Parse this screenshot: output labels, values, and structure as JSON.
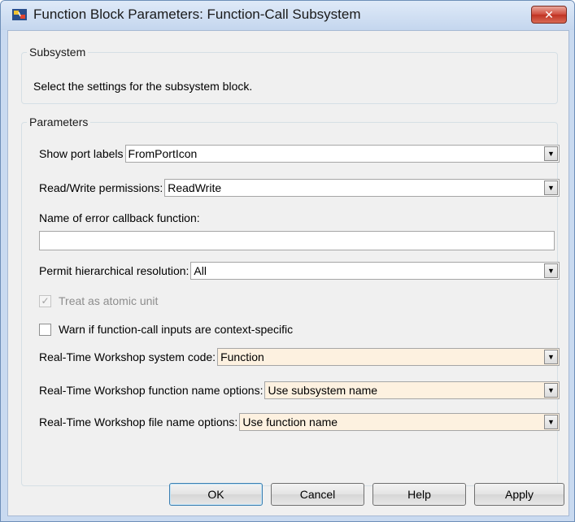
{
  "window": {
    "title": "Function Block Parameters: Function-Call Subsystem",
    "close_label": "✕"
  },
  "subsystem_group": {
    "legend": "Subsystem",
    "description": "Select the settings for the subsystem block."
  },
  "parameters_group": {
    "legend": "Parameters",
    "show_port_labels": {
      "label": "Show port labels",
      "value": "FromPortIcon"
    },
    "read_write_permissions": {
      "label": "Read/Write permissions:",
      "value": "ReadWrite"
    },
    "error_callback": {
      "label": "Name of error callback function:",
      "value": ""
    },
    "hierarchical_resolution": {
      "label": "Permit hierarchical resolution:",
      "value": "All"
    },
    "treat_atomic": {
      "label": "Treat as atomic unit",
      "checked": true,
      "enabled": false,
      "mark": "✓"
    },
    "warn_context": {
      "label": "Warn if function-call inputs are context-specific",
      "checked": false,
      "enabled": true
    },
    "rtw_system_code": {
      "label": "Real-Time Workshop system code:",
      "value": "Function"
    },
    "rtw_function_name": {
      "label": "Real-Time Workshop function name options:",
      "value": "Use subsystem name"
    },
    "rtw_file_name": {
      "label": "Real-Time Workshop file name options:",
      "value": "Use function name"
    }
  },
  "buttons": {
    "ok": "OK",
    "cancel": "Cancel",
    "help": "Help",
    "apply": "Apply"
  },
  "colors": {
    "frame": "#c9daf0",
    "client": "#f0f0f0",
    "rtw_field": "#fdf1e0",
    "close_button": "#c9402f"
  },
  "icons": {
    "app": "simulink-block-icon",
    "close": "close-icon",
    "dropdown": "chevron-down-icon",
    "check": "checkmark-icon"
  }
}
